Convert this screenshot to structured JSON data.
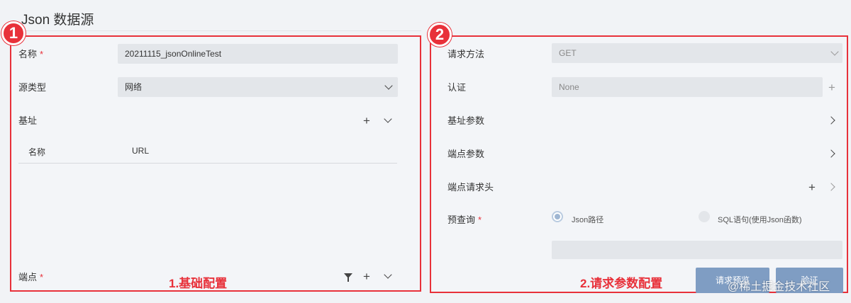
{
  "page_title": "Json 数据源",
  "badges": {
    "left": "1",
    "right": "2"
  },
  "left": {
    "name_label": "名称",
    "required_mark": "*",
    "name_value": "20211115_jsonOnlineTest",
    "source_type_label": "源类型",
    "source_type_value": "网络",
    "base_label": "基址",
    "table_headers": [
      "名称",
      "URL"
    ],
    "endpoint_label": "端点",
    "caption": "1.基础配置"
  },
  "right": {
    "method_label": "请求方法",
    "method_value": "GET",
    "auth_label": "认证",
    "auth_value": "None",
    "base_params_label": "基址参数",
    "endpoint_params_label": "端点参数",
    "endpoint_headers_label": "端点请求头",
    "prequery_label": "预查询",
    "radio_json": "Json路径",
    "radio_sql": "SQL语句(使用Json函数)",
    "caption": "2.请求参数配置",
    "btn_preview": "请求预览",
    "btn_verify": "验证"
  },
  "watermark": "@稀土掘金技术社区"
}
